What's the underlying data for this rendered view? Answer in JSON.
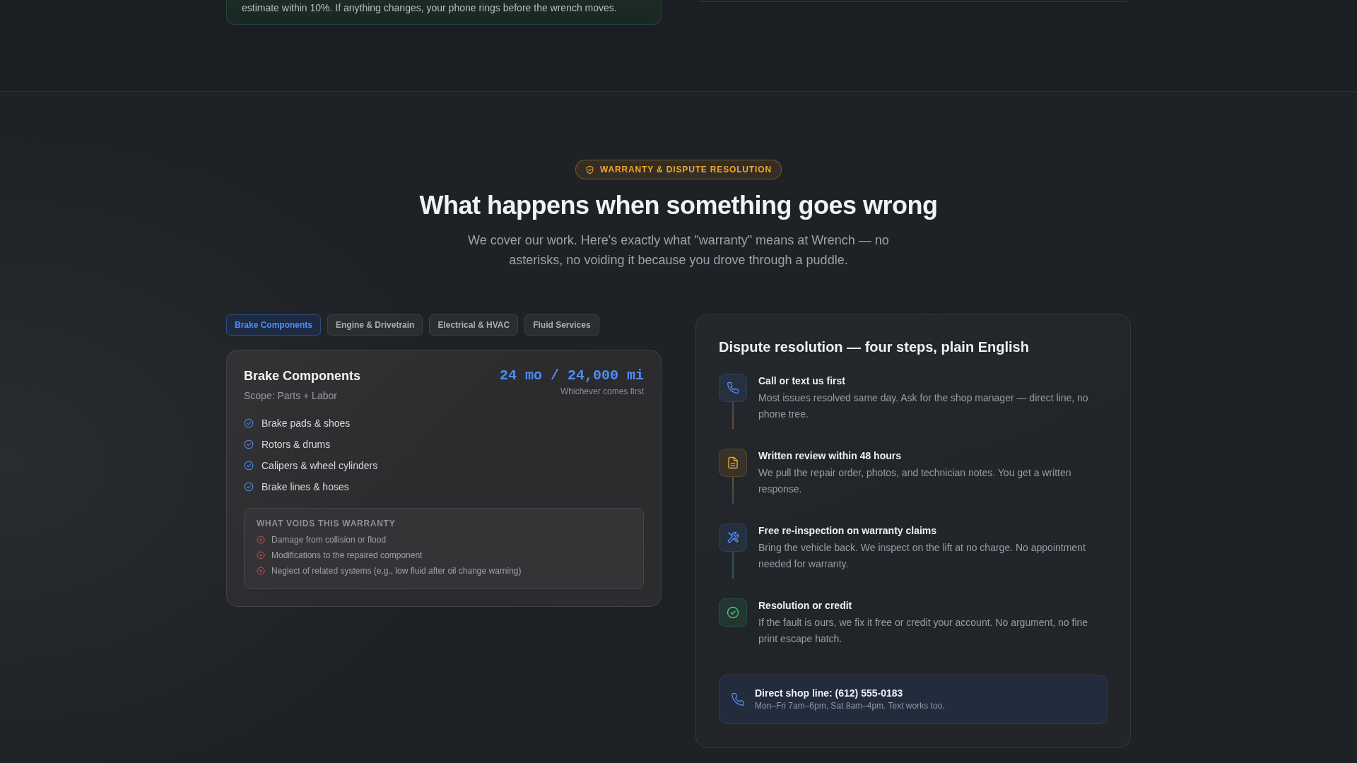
{
  "previous_section": {
    "note_card": {
      "text": "estimate within 10%. If anything changes, your phone rings before the wrench moves."
    }
  },
  "warranty_section": {
    "badge": "WARRANTY & DISPUTE RESOLUTION",
    "title": "What happens when something goes wrong",
    "subtitle": "We cover our work. Here's exactly what \"warranty\" means at Wrench — no asterisks, no voiding it because you drove through a puddle.",
    "tabs": [
      {
        "label": "Brake Components",
        "selected": true
      },
      {
        "label": "Engine & Drivetrain",
        "selected": false
      },
      {
        "label": "Electrical & HVAC",
        "selected": false
      },
      {
        "label": "Fluid Services",
        "selected": false
      }
    ],
    "coverage_card": {
      "title": "Brake Components",
      "scope": "Scope: Parts + Labor",
      "term": "24 mo / 24,000 mi",
      "term_note": "Whichever comes first",
      "covered_items": [
        "Brake pads & shoes",
        "Rotors & drums",
        "Calipers & wheel cylinders",
        "Brake lines & hoses"
      ],
      "voids": {
        "heading": "WHAT VOIDS THIS WARRANTY",
        "items": [
          "Damage from collision or flood",
          "Modifications to the repaired component",
          "Neglect of related systems (e.g., low fluid after oil change warning)"
        ]
      }
    }
  },
  "dispute_card": {
    "title": "Dispute resolution — four steps, plain English",
    "steps": [
      {
        "title": "Call or text us first",
        "description": "Most issues resolved same day. Ask for the shop manager — direct line, no phone tree.",
        "color": "#4f8ef7"
      },
      {
        "title": "Written review within 48 hours",
        "description": "We pull the repair order, photos, and technician notes. You get a written response.",
        "color": "#f5a524"
      },
      {
        "title": "Free re-inspection on warranty claims",
        "description": "Bring the vehicle back. We inspect on the lift at no charge. No appointment needed for warranty.",
        "color": "#4f8ef7"
      },
      {
        "title": "Resolution or credit",
        "description": "If the fault is ours, we fix it free or credit your account. No argument, no fine print escape hatch.",
        "color": "#3ecf72"
      }
    ],
    "contact": {
      "title": "Direct shop line: (612) 555-0183",
      "hours": "Mon–Fri 7am–6pm, Sat 8am–4pm. Text works too."
    }
  }
}
